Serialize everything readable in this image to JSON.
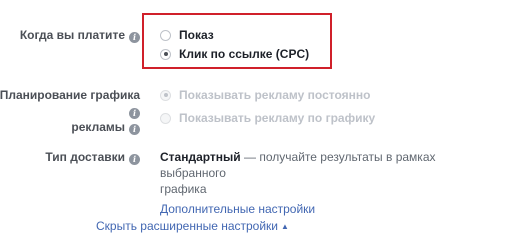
{
  "payment": {
    "label": "Когда вы платите",
    "options": [
      {
        "label": "Показ",
        "selected": false
      },
      {
        "label": "Клик по ссылке (CPC)",
        "selected": true
      }
    ]
  },
  "schedule": {
    "label_line1": "Планирование графика",
    "label_line2": "рекламы",
    "options": [
      {
        "label": "Показывать рекламу постоянно",
        "selected": true,
        "disabled": true
      },
      {
        "label": "Показывать рекламу по графику",
        "selected": false,
        "disabled": true
      }
    ]
  },
  "delivery": {
    "label": "Тип доставки",
    "type": "Стандартный",
    "description_line1": "— получайте результаты в рамках выбранного",
    "description_line2": "графика",
    "more_settings_link": "Дополнительные настройки"
  },
  "advanced_toggle": {
    "label": "Скрыть расширенные настройки",
    "icon": "caret-up-icon"
  },
  "colors": {
    "highlight_border": "#d0202a",
    "link": "#4267b2",
    "label": "#4b4f56"
  }
}
